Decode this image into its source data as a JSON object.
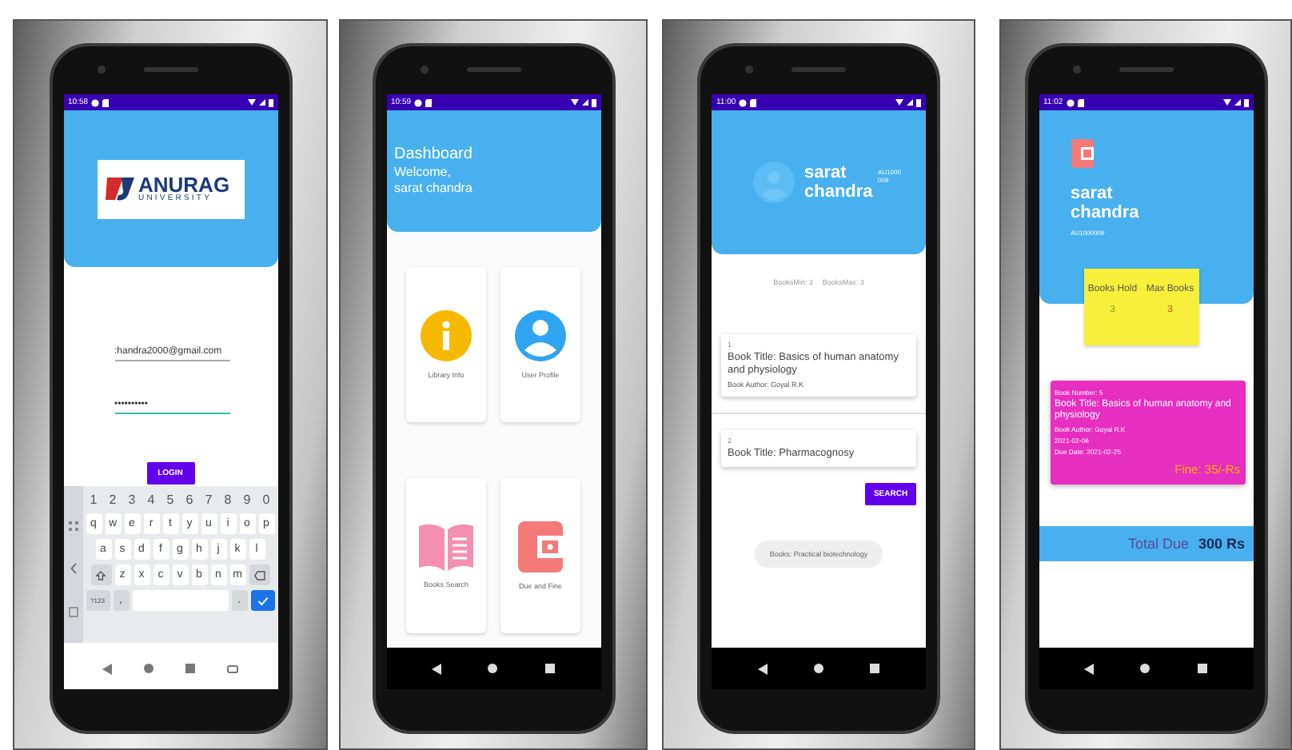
{
  "screens": [
    {
      "kind": "login",
      "status_time": "10:58",
      "nav_dark": false,
      "logo": {
        "name": "ANURAG",
        "subtitle": "UNIVERSITY"
      },
      "email": {
        "value": ":handra2000@gmail.com",
        "focused": false
      },
      "password": {
        "value": "••••••••••",
        "focused": true
      },
      "login_button": "LOGIN",
      "keyboard": {
        "rows": [
          [
            "1",
            "2",
            "3",
            "4",
            "5",
            "6",
            "7",
            "8",
            "9",
            "0"
          ],
          [
            "q",
            "w",
            "e",
            "r",
            "t",
            "y",
            "u",
            "i",
            "o",
            "p"
          ],
          [
            "a",
            "s",
            "d",
            "f",
            "g",
            "h",
            "j",
            "k",
            "l"
          ],
          [
            "z",
            "x",
            "c",
            "v",
            "b",
            "n",
            "m"
          ]
        ],
        "symbols_key": "?123",
        "comma_key": ",",
        "period_key": "."
      }
    },
    {
      "kind": "dashboard",
      "status_time": "10:59",
      "nav_dark": true,
      "title": "Dashboard",
      "welcome": "Welcome,",
      "user": "sarat chandra",
      "tiles": [
        {
          "kind": "info",
          "label": "Library Info"
        },
        {
          "kind": "profile",
          "label": "User Profile"
        },
        {
          "kind": "book",
          "label": "Books Search"
        },
        {
          "kind": "wallet",
          "label": "Due and Fine"
        }
      ]
    },
    {
      "kind": "search",
      "status_time": "11:00",
      "nav_dark": true,
      "user": "sarat chandra",
      "user_id": "AU1000009",
      "books_min": "BooksMin: 3",
      "books_max": "BooksMax: 3",
      "books": [
        {
          "number": "1",
          "title": "Book Title: Basics of human anatomy and physiology",
          "author": "Book Author: Goyal R.K"
        },
        {
          "number": "2",
          "title": "Book Title: Pharmacognosy"
        }
      ],
      "search_button": "SEARCH",
      "toast": "Books: Practical biotechnology"
    },
    {
      "kind": "due",
      "status_time": "11:02",
      "nav_dark": true,
      "user": "sarat chandra",
      "user_id": "AU1000009",
      "stats": [
        {
          "label": "Books Hold",
          "value": "3",
          "color": "#8aa830"
        },
        {
          "label": "Max Books",
          "value": "3",
          "color": "#e8402a"
        }
      ],
      "due_book": {
        "number": "Book Number: 5",
        "title": "Book Title: Basics of human anatomy and physiology",
        "author": "Book Author: Goyal R.K",
        "issued": "2021-02-06",
        "due_date": "Due Date: 2021-02-25",
        "fine": "Fine: 35/-Rs"
      },
      "total_label": "Total Due",
      "total_value": "300 Rs"
    }
  ]
}
